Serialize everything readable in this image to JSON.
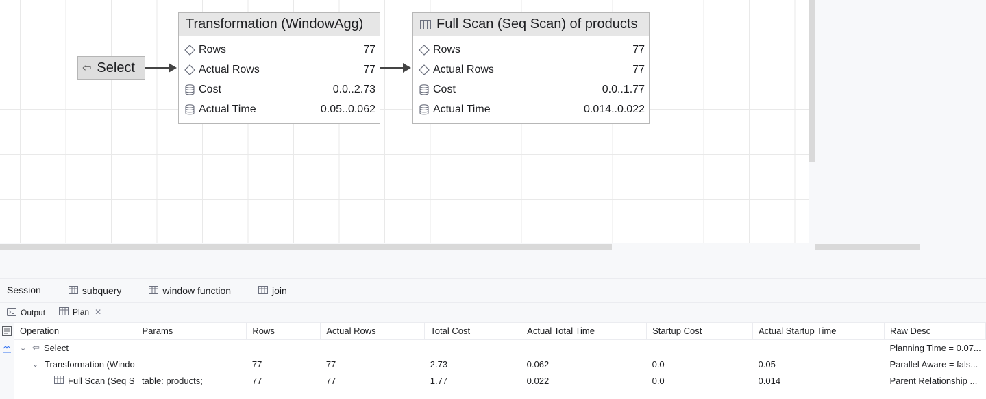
{
  "diagram": {
    "select_node": {
      "label": "Select"
    },
    "nodes": [
      {
        "title": "Transformation (WindowAgg)",
        "rows": [
          {
            "label": "Rows",
            "value": "77",
            "icon": "diamond-icon"
          },
          {
            "label": "Actual Rows",
            "value": "77",
            "icon": "diamond-icon"
          },
          {
            "label": "Cost",
            "value": "0.0..2.73",
            "icon": "database-icon"
          },
          {
            "label": "Actual Time",
            "value": "0.05..0.062",
            "icon": "database-icon"
          }
        ]
      },
      {
        "title": "Full Scan (Seq Scan) of products",
        "title_icon": "table-icon",
        "rows": [
          {
            "label": "Rows",
            "value": "77",
            "icon": "diamond-icon"
          },
          {
            "label": "Actual Rows",
            "value": "77",
            "icon": "diamond-icon"
          },
          {
            "label": "Cost",
            "value": "0.0..1.77",
            "icon": "database-icon"
          },
          {
            "label": "Actual Time",
            "value": "0.014..0.022",
            "icon": "database-icon"
          }
        ]
      }
    ]
  },
  "session_tabs": [
    {
      "label": "Session",
      "active": true
    },
    {
      "label": "subquery",
      "icon": "table-icon"
    },
    {
      "label": "window function",
      "icon": "table-icon"
    },
    {
      "label": "join",
      "icon": "table-icon"
    }
  ],
  "tool_tabs": [
    {
      "label": "Output",
      "icon": "console-icon"
    },
    {
      "label": "Plan",
      "icon": "table-icon",
      "active": true,
      "closable": true
    }
  ],
  "plan_table": {
    "columns": [
      "Operation",
      "Params",
      "Rows",
      "Actual Rows",
      "Total Cost",
      "Actual Total Time",
      "Startup Cost",
      "Actual Startup Time",
      "Raw Desc"
    ],
    "rows": [
      {
        "operation": "Select",
        "params": "",
        "rows": "",
        "actual_rows": "",
        "total_cost": "",
        "actual_total_time": "",
        "startup_cost": "",
        "actual_startup_time": "",
        "raw_desc": "Planning Time = 0.07..."
      },
      {
        "operation": "Transformation (Windo",
        "params": "",
        "rows": "77",
        "actual_rows": "77",
        "total_cost": "2.73",
        "actual_total_time": "0.062",
        "startup_cost": "0.0",
        "actual_startup_time": "0.05",
        "raw_desc": "Parallel Aware = fals..."
      },
      {
        "operation": "Full Scan (Seq S",
        "params": "table: products;",
        "rows": "77",
        "actual_rows": "77",
        "total_cost": "1.77",
        "actual_total_time": "0.022",
        "startup_cost": "0.0",
        "actual_startup_time": "0.014",
        "raw_desc": "Parent Relationship ..."
      }
    ]
  }
}
